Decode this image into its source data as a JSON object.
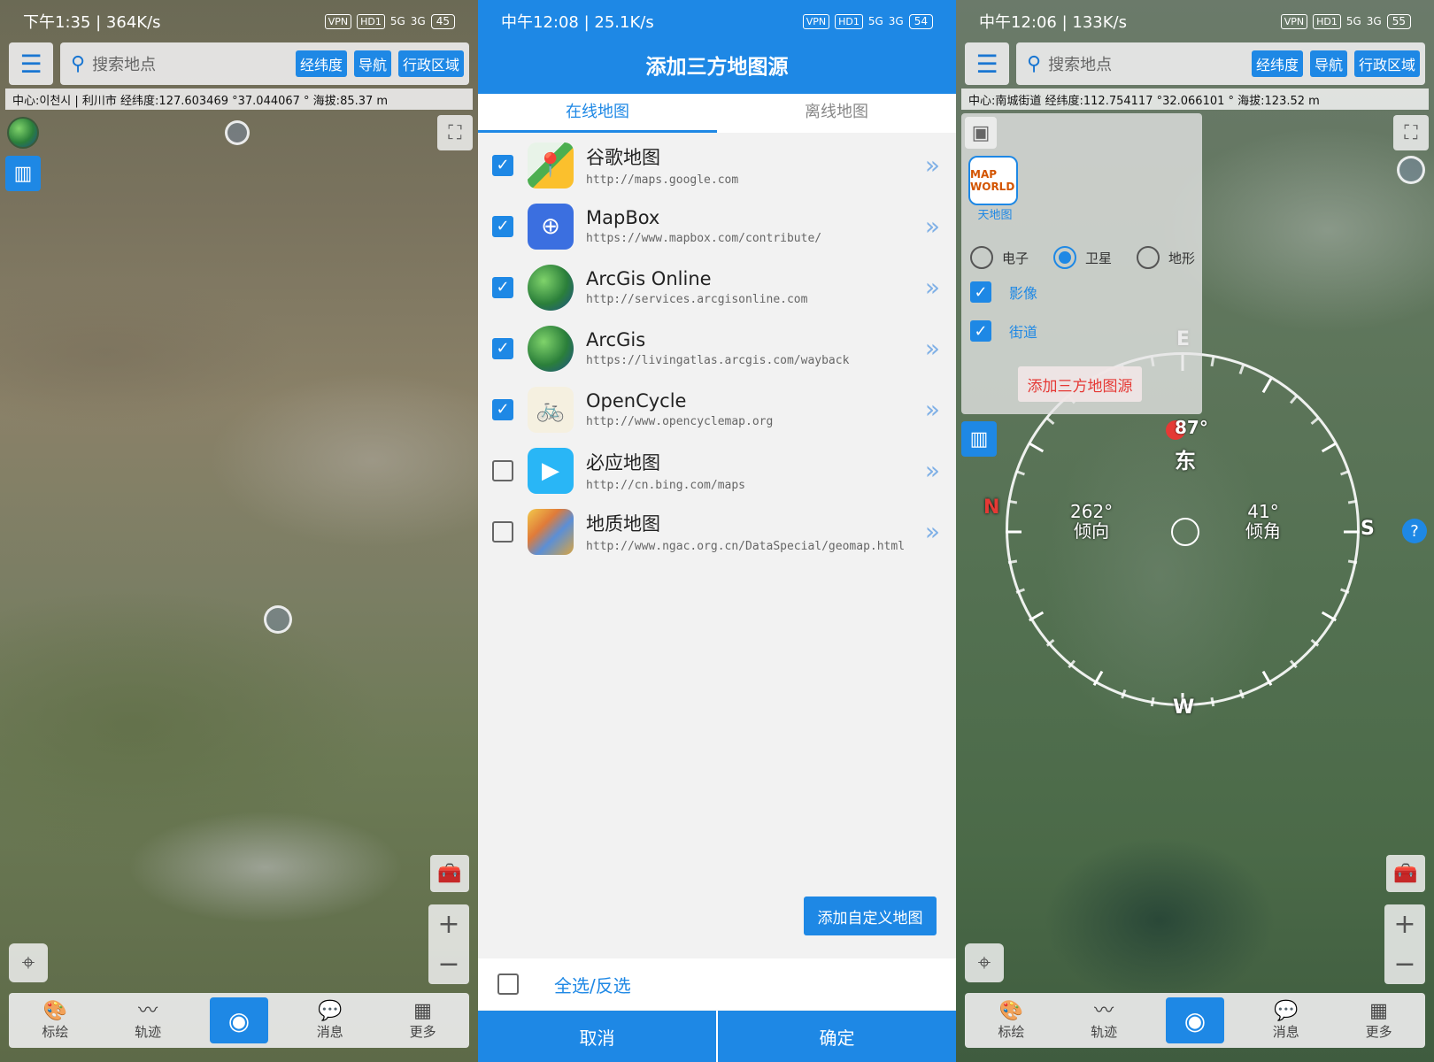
{
  "left": {
    "status": {
      "time": "下午1:35 | 364K/s",
      "battery": "45",
      "vpn": "VPN",
      "hd": "HD1",
      "net1": "5G",
      "net2": "3G"
    },
    "search": {
      "placeholder": "搜索地点",
      "chips": [
        "经纬度",
        "导航",
        "行政区域"
      ]
    },
    "info": "中心:이천시 | 利川市 经纬度:127.603469 °37.044067 ° 海拔:85.37 m",
    "nav": [
      {
        "label": "标绘",
        "icon": "palette-icon"
      },
      {
        "label": "轨迹",
        "icon": "track-icon"
      },
      {
        "label": "",
        "icon": "camera-icon"
      },
      {
        "label": "消息",
        "icon": "message-icon"
      },
      {
        "label": "更多",
        "icon": "grid-icon"
      }
    ]
  },
  "center": {
    "status": {
      "time": "中午12:08 | 25.1K/s",
      "battery": "54",
      "vpn": "VPN",
      "hd": "HD1",
      "net1": "5G",
      "net2": "3G"
    },
    "title": "添加三方地图源",
    "tabs": [
      "在线地图",
      "离线地图"
    ],
    "sources": [
      {
        "name": "谷歌地图",
        "url": "http://maps.google.com",
        "checked": true,
        "icon": "google-maps-icon"
      },
      {
        "name": "MapBox",
        "url": "https://www.mapbox.com/contribute/",
        "checked": true,
        "icon": "mapbox-icon"
      },
      {
        "name": "ArcGis Online",
        "url": "http://services.arcgisonline.com",
        "checked": true,
        "icon": "globe-icon"
      },
      {
        "name": "ArcGis",
        "url": "https://livingatlas.arcgis.com/wayback",
        "checked": true,
        "icon": "globe-icon"
      },
      {
        "name": "OpenCycle",
        "url": "http://www.opencyclemap.org",
        "checked": true,
        "icon": "opencycle-icon"
      },
      {
        "name": "必应地图",
        "url": "http://cn.bing.com/maps",
        "checked": false,
        "icon": "bing-maps-icon"
      },
      {
        "name": "地质地图",
        "url": "http://www.ngac.org.cn/DataSpecial/geomap.html",
        "checked": false,
        "icon": "geology-map-icon"
      }
    ],
    "add_custom": "添加自定义地图",
    "select_all": "全选/反选",
    "cancel": "取消",
    "confirm": "确定"
  },
  "right": {
    "status": {
      "time": "中午12:06 | 133K/s",
      "battery": "55",
      "vpn": "VPN",
      "hd": "HD1",
      "net1": "5G",
      "net2": "3G"
    },
    "search": {
      "placeholder": "搜索地点",
      "chips": [
        "经纬度",
        "导航",
        "行政区域"
      ]
    },
    "info": "中心:南城街道 经纬度:112.754117 °32.066101 ° 海拔:123.52 m",
    "layer": {
      "provider": "天地图",
      "provider_logo": "MAP WORLD",
      "modes": [
        {
          "label": "电子",
          "selected": false
        },
        {
          "label": "卫星",
          "selected": true
        },
        {
          "label": "地形",
          "selected": false
        }
      ],
      "overlays": [
        {
          "label": "影像",
          "checked": true
        },
        {
          "label": "街道",
          "checked": true
        }
      ],
      "add_third": "添加三方地图源"
    },
    "compass": {
      "heading_value": "87°",
      "heading_dir": "东",
      "dip_direction": "262°",
      "dip_direction_label": "倾向",
      "dip_angle": "41°",
      "dip_angle_label": "倾角",
      "cardinals": {
        "n": "N",
        "e": "E",
        "s": "S",
        "w": "W"
      }
    },
    "help": "?",
    "nav": [
      {
        "label": "标绘",
        "icon": "palette-icon"
      },
      {
        "label": "轨迹",
        "icon": "track-icon"
      },
      {
        "label": "",
        "icon": "camera-icon"
      },
      {
        "label": "消息",
        "icon": "message-icon"
      },
      {
        "label": "更多",
        "icon": "grid-icon"
      }
    ]
  }
}
